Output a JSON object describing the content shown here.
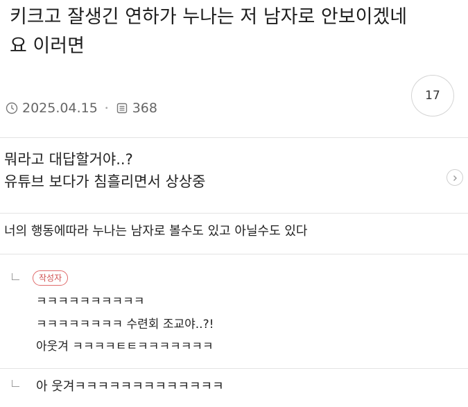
{
  "post": {
    "title": "키크고 잘생긴 연하가 누나는 저 남자로 안보이겠네요 이러면",
    "date": "2025.04.15",
    "views": "368",
    "comment_count": "17",
    "icons": {
      "date": "clock-icon",
      "views": "document-icon"
    }
  },
  "snippet": {
    "line1": "뭐라고 대답할거야..?",
    "line2": "유튜브 보다가 침흘리면서 상상중",
    "nav_icon": "chevron-right-icon"
  },
  "comments": [
    {
      "text": "너의 행동에따라 누나는 남자로 볼수도 있고 아닐수도 있다"
    },
    {
      "badge": "작성자",
      "lines": [
        "ㅋㅋㅋㅋㅋㅋㅋㅋㅋㅋ",
        "ㅋㅋㅋㅋㅋㅋㅋㅋ 수련회 조교야..?!",
        "아웃겨 ㅋㅋㅋㅋㅌㅌㅋㅋㅋㅋㅋㅋㅋ"
      ]
    },
    {
      "text": "아 웃겨ㅋㅋㅋㅋㅋㅋㅋㅋㅋㅋㅋㅋㅋ"
    }
  ],
  "colors": {
    "badge": "#d05050",
    "divider": "#e3e3e3",
    "meta_text": "#666666"
  }
}
